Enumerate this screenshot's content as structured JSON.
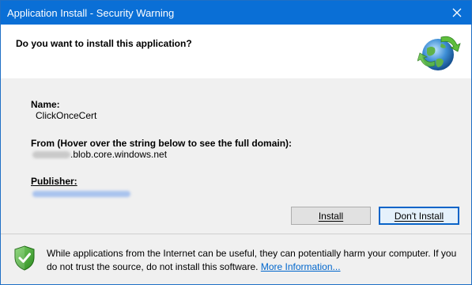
{
  "window": {
    "title": "Application Install - Security Warning",
    "close_icon": "close-icon",
    "accent_color": "#0a6fd6"
  },
  "header": {
    "question": "Do you want to install this application?",
    "app_icon": "globe-install-icon"
  },
  "details": {
    "name_label": "Name:",
    "name_value": "ClickOnceCert",
    "from_label": "From (Hover over the string below to see the full domain):",
    "from_value_suffix": ".blob.core.windows.net",
    "publisher_label": "Publisher:"
  },
  "buttons": {
    "install": "Install",
    "dont_install": "Don't Install"
  },
  "footer": {
    "shield_icon": "shield-check-icon",
    "warning_text": "While applications from the Internet can be useful, they can potentially harm your computer. If you do not trust the source, do not install this software.",
    "more_info_link": "More Information..."
  }
}
